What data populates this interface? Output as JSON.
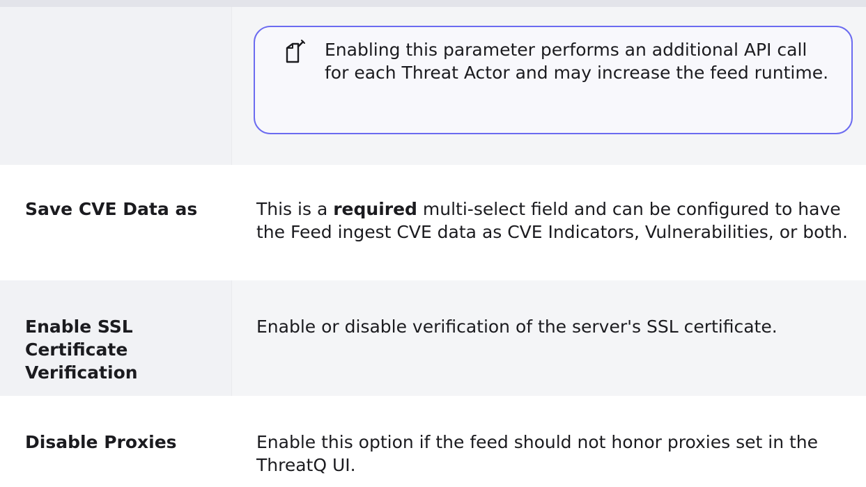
{
  "rows": {
    "proxy_note": {
      "note": {
        "icon": "note-edit-icon",
        "text": "Enabling this parameter performs an additional API call for each Threat Actor and may increase the feed runtime."
      }
    },
    "save_cve": {
      "label": "Save CVE Data as",
      "desc_pre": "This is a ",
      "desc_bold": "required",
      "desc_post": " multi-select field and can be configured to have the Feed ingest CVE data as CVE Indicators, Vulnerabilities, or both."
    },
    "ssl": {
      "label": "Enable SSL Certificate Verification",
      "desc": "Enable or disable verification of the server's SSL certificate."
    },
    "proxies": {
      "label": "Disable Proxies",
      "desc": "Enable this option if the feed should not honor proxies set in the ThreatQ UI."
    }
  },
  "colors": {
    "note_border": "#6b6bf0",
    "shaded_row": "#f4f5f7",
    "text": "#1b1b1f"
  }
}
